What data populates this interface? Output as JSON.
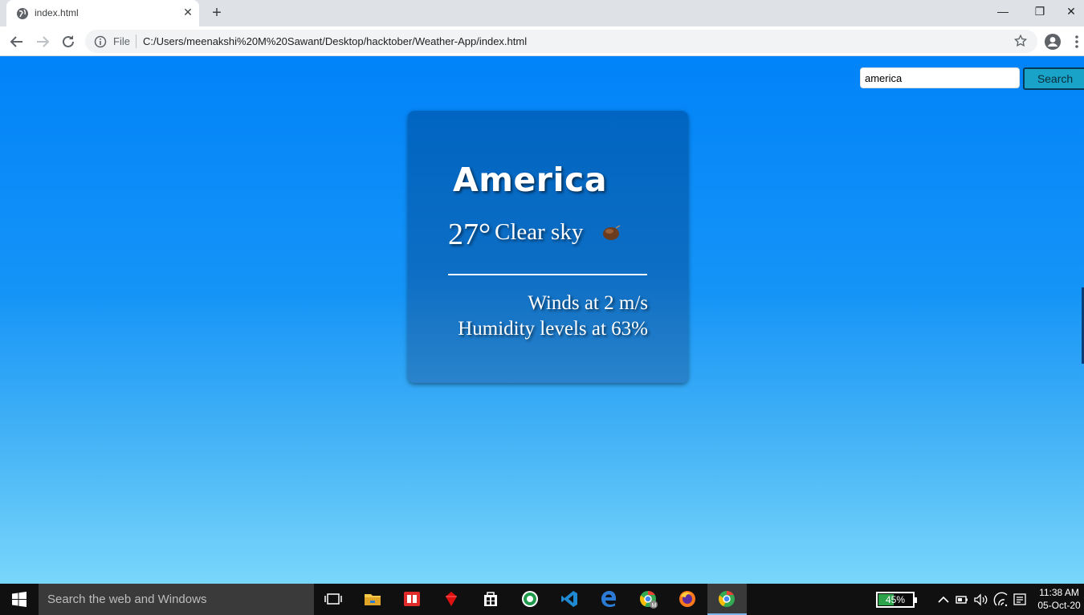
{
  "browser": {
    "tab_title": "index.html",
    "new_tab_symbol": "+",
    "close_tab_symbol": "✕",
    "address_scheme_label": "File",
    "address_url": "C:/Users/meenakshi%20M%20Sawant/Desktop/hacktober/Weather-App/index.html",
    "window_controls": {
      "minimize": "—",
      "restore": "❐",
      "close": "✕"
    }
  },
  "search": {
    "query": "america",
    "button_label": "Search"
  },
  "weather": {
    "city": "America",
    "temperature": "27°",
    "description": "Clear sky",
    "icon": "clear-sky-icon",
    "wind": "Winds at 2 m/s",
    "humidity": "Humidity levels at 63%"
  },
  "taskbar": {
    "search_placeholder": "Search the web and Windows",
    "apps": [
      "task-view-icon",
      "file-explorer-icon",
      "reader-icon",
      "ruby-icon",
      "store-icon",
      "ccleaner-icon",
      "vscode-icon",
      "edge-icon",
      "chrome-profile-icon",
      "firefox-icon",
      "chrome-icon"
    ],
    "battery_label": "45%",
    "battery_level": 0.45,
    "time": "11:38 AM",
    "date": "05-Oct-20"
  },
  "colors": {
    "page_sky_top": "#0183f9",
    "page_sky_bottom": "#79d6fb",
    "card": "#0065c2",
    "search_button": "#19a3c9"
  }
}
